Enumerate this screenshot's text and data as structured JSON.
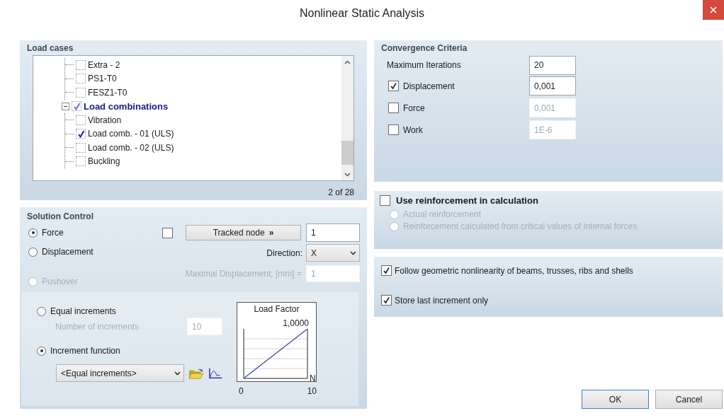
{
  "window": {
    "title": "Nonlinear Static Analysis"
  },
  "load_cases": {
    "title": "Load cases",
    "counter": "2 of 28",
    "tree": [
      {
        "children": [
          {
            "label": "Extra - 2",
            "checked": false
          },
          {
            "label": "PS1-T0",
            "checked": false
          },
          {
            "label": "FESZ1-T0",
            "checked": false
          }
        ]
      },
      {
        "label": "Load combinations",
        "checked": true,
        "partial": true,
        "expanded": true,
        "children": [
          {
            "label": "Vibration",
            "checked": false
          },
          {
            "label": "Load comb. - 01 (ULS)",
            "checked": true
          },
          {
            "label": "Load comb. - 02 (ULS)",
            "checked": false
          },
          {
            "label": "Buckling",
            "checked": false
          }
        ]
      }
    ]
  },
  "solution_control": {
    "title": "Solution Control",
    "modes": [
      {
        "label": "Force",
        "selected": true,
        "disabled": false
      },
      {
        "label": "Displacement",
        "selected": false,
        "disabled": false
      },
      {
        "label": "Pushover",
        "selected": false,
        "disabled": true
      }
    ],
    "tracked_node": {
      "checked": false,
      "button": "Tracked node",
      "button_icon": "»",
      "value": "1"
    },
    "direction": {
      "label": "Direction:",
      "value": "X"
    },
    "max_displacement": {
      "label": "Maximal Displacement; [mm] =",
      "value": "1",
      "disabled": true
    },
    "increment_modes": [
      {
        "label": "Equal increments",
        "selected": false
      },
      {
        "label": "Increment function",
        "selected": true
      }
    ],
    "number_of_increments": {
      "label": "Number of increments",
      "value": "10",
      "disabled": true
    },
    "function": {
      "value": "<Equal increments>"
    },
    "graph": {
      "title": "Load Factor",
      "value_label": "1,0000",
      "axis_label": "N",
      "x_labels": [
        "0",
        "10"
      ]
    }
  },
  "convergence": {
    "title": "Convergence Criteria",
    "max_iterations": {
      "label": "Maximum Iterations",
      "value": "20"
    },
    "criteria": [
      {
        "label": "Displacement",
        "checked": true,
        "value": "0,001"
      },
      {
        "label": "Force",
        "checked": false,
        "value": "0,001"
      },
      {
        "label": "Work",
        "checked": false,
        "value": "1E-6"
      }
    ]
  },
  "reinforcement": {
    "label": "Use reinforcement in calculation",
    "checked": false,
    "options": [
      {
        "label": "Actual reinforcement",
        "selected": false,
        "disabled": true
      },
      {
        "label": "Reinforcement calculated from critical values of internal forces",
        "selected": false,
        "disabled": true
      }
    ]
  },
  "options": [
    {
      "label": "Follow geometric nonlinearity of beams, trusses, ribs and shells",
      "checked": true
    },
    {
      "label": "Store last increment only",
      "checked": true
    }
  ],
  "buttons": [
    {
      "label": "OK",
      "default": true
    },
    {
      "label": "Cancel",
      "default": false
    }
  ]
}
